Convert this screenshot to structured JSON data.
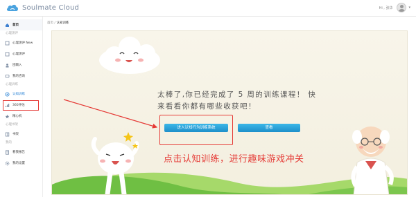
{
  "header": {
    "app_title": "Soulmate Cloud",
    "greeting": "Hi , 张华",
    "caret": "▾"
  },
  "sidebar": {
    "items": [
      {
        "type": "item",
        "label": "首页",
        "icon": "home-icon"
      },
      {
        "type": "section",
        "label": "心理测评"
      },
      {
        "type": "item",
        "label": "心理测评 New",
        "icon": "test-icon"
      },
      {
        "type": "item",
        "label": "心理测评",
        "icon": "test-icon"
      },
      {
        "type": "item",
        "label": "团辅入",
        "icon": "group-icon"
      },
      {
        "type": "item",
        "label": "我的咨询",
        "icon": "chat-icon"
      },
      {
        "type": "section",
        "label": "心理训练"
      },
      {
        "type": "item",
        "label": "认知训练",
        "icon": "brain-icon",
        "selected": true
      },
      {
        "type": "item",
        "label": "360评估",
        "icon": "chart-icon"
      },
      {
        "type": "item",
        "label": "精心机",
        "icon": "star-icon"
      },
      {
        "type": "section",
        "label": "心理书架"
      },
      {
        "type": "item",
        "label": "书架",
        "icon": "book-icon"
      },
      {
        "type": "section",
        "label": "我的"
      },
      {
        "type": "item",
        "label": "看我报告",
        "icon": "report-icon"
      },
      {
        "type": "item",
        "label": "我的设置",
        "icon": "settings-icon"
      }
    ]
  },
  "breadcrumb": {
    "home": "首页",
    "sep": " / ",
    "current": "认知训练"
  },
  "main": {
    "message_line1": "太棒了,你已经完成了 5 周的训练课程！ 快",
    "message_line2": "来看看你都有哪些收获吧！",
    "enter_button_label": "进入认知行为训练系统",
    "view_button_label": "查看",
    "annotation_caption": "点击认知训练，进行趣味游戏冲关"
  },
  "colors": {
    "accent": "#2f86d6",
    "button": "#1e8fca",
    "annotation": "#e53935",
    "panel_bg": "#f6f3e6",
    "hill": "#6fbf43"
  }
}
